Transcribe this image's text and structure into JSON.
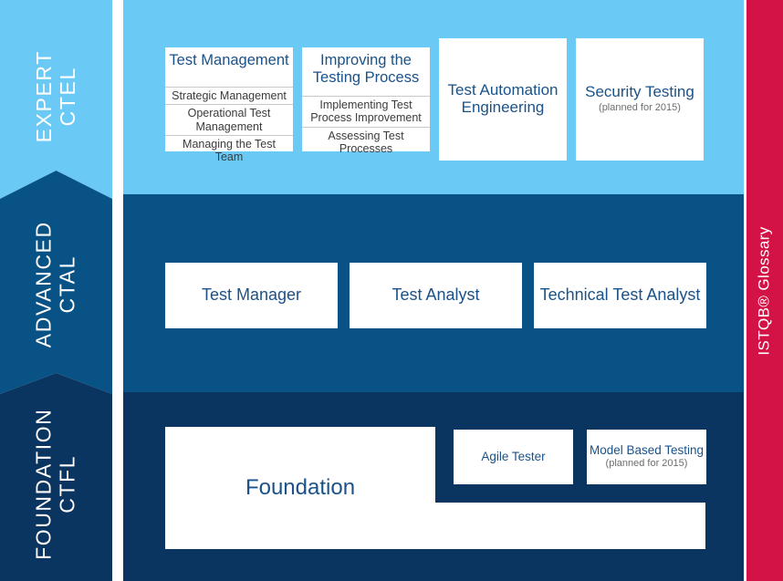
{
  "levels": [
    {
      "name": "EXPERT",
      "abbr": "CTEL",
      "color": "#6BCAF5"
    },
    {
      "name": "ADVANCED",
      "abbr": "CTAL",
      "color": "#095286"
    },
    {
      "name": "FOUNDATION",
      "abbr": "CTFL",
      "color": "#0A3560"
    }
  ],
  "expert": {
    "modular_cards": [
      {
        "title": "Test Management",
        "modules": [
          "Strategic Management",
          "Operational Test Management",
          "Managing the Test Team"
        ]
      },
      {
        "title": "Improving the Testing Process",
        "modules": [
          "Implementing Test Process Improvement",
          "Assessing Test Processes"
        ]
      }
    ],
    "plain_cards": [
      {
        "title": "Test Automation Engineering",
        "note": ""
      },
      {
        "title": "Security Testing",
        "note": "(planned for 2015)"
      }
    ]
  },
  "advanced": {
    "cards": [
      {
        "title": "Test Manager"
      },
      {
        "title": "Test Analyst"
      },
      {
        "title": "Technical Test Analyst"
      }
    ]
  },
  "foundation": {
    "main": {
      "title": "Foundation"
    },
    "extensions": [
      {
        "title": "Agile Tester",
        "note": ""
      },
      {
        "title": "Model Based Testing",
        "note": "(planned for 2015)"
      }
    ]
  },
  "glossary": {
    "label": "ISTQB® Glossary"
  },
  "colors": {
    "expert_band": "#6BCAF5",
    "advanced_band": "#095286",
    "foundation_band": "#0A3560",
    "glossary_bar": "#D31245",
    "card_text": "#1A5289",
    "note_text": "#6d6d6d",
    "card_bg": "#ffffff"
  }
}
